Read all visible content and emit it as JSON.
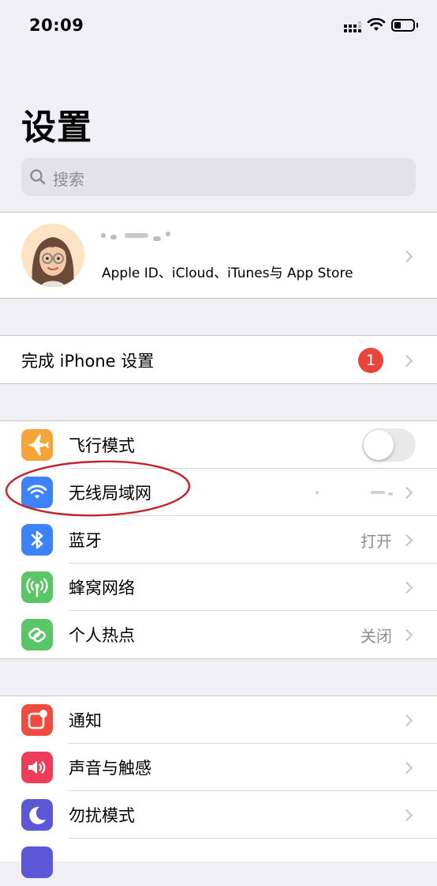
{
  "status_bar": {
    "time": "20:09"
  },
  "header": {
    "title": "设置"
  },
  "search": {
    "placeholder": "搜索"
  },
  "profile": {
    "subtitle": "Apple ID、iCloud、iTunes与 App Store"
  },
  "setup": {
    "label": "完成 iPhone 设置",
    "badge": "1"
  },
  "connectivity": {
    "items": [
      {
        "label": "飞行模式",
        "icon": "airplane-icon",
        "color": "#f5a43a",
        "toggle": false
      },
      {
        "label": "无线局域网",
        "icon": "wifi-icon",
        "color": "#3d83f7"
      },
      {
        "label": "蓝牙",
        "icon": "bluetooth-icon",
        "color": "#3d83f7",
        "value": "打开"
      },
      {
        "label": "蜂窝网络",
        "icon": "antenna-icon",
        "color": "#5bc667"
      },
      {
        "label": "个人热点",
        "icon": "hotspot-icon",
        "color": "#5bc667",
        "value": "关闭"
      }
    ]
  },
  "notifications_group": {
    "items": [
      {
        "label": "通知",
        "icon": "notification-icon",
        "color": "#ef4b3f"
      },
      {
        "label": "声音与触感",
        "icon": "speaker-icon",
        "color": "#ee3c5b"
      },
      {
        "label": "勿扰模式",
        "icon": "moon-icon",
        "color": "#5b57d6"
      }
    ]
  },
  "annotation": {
    "color": "#c0242c"
  }
}
